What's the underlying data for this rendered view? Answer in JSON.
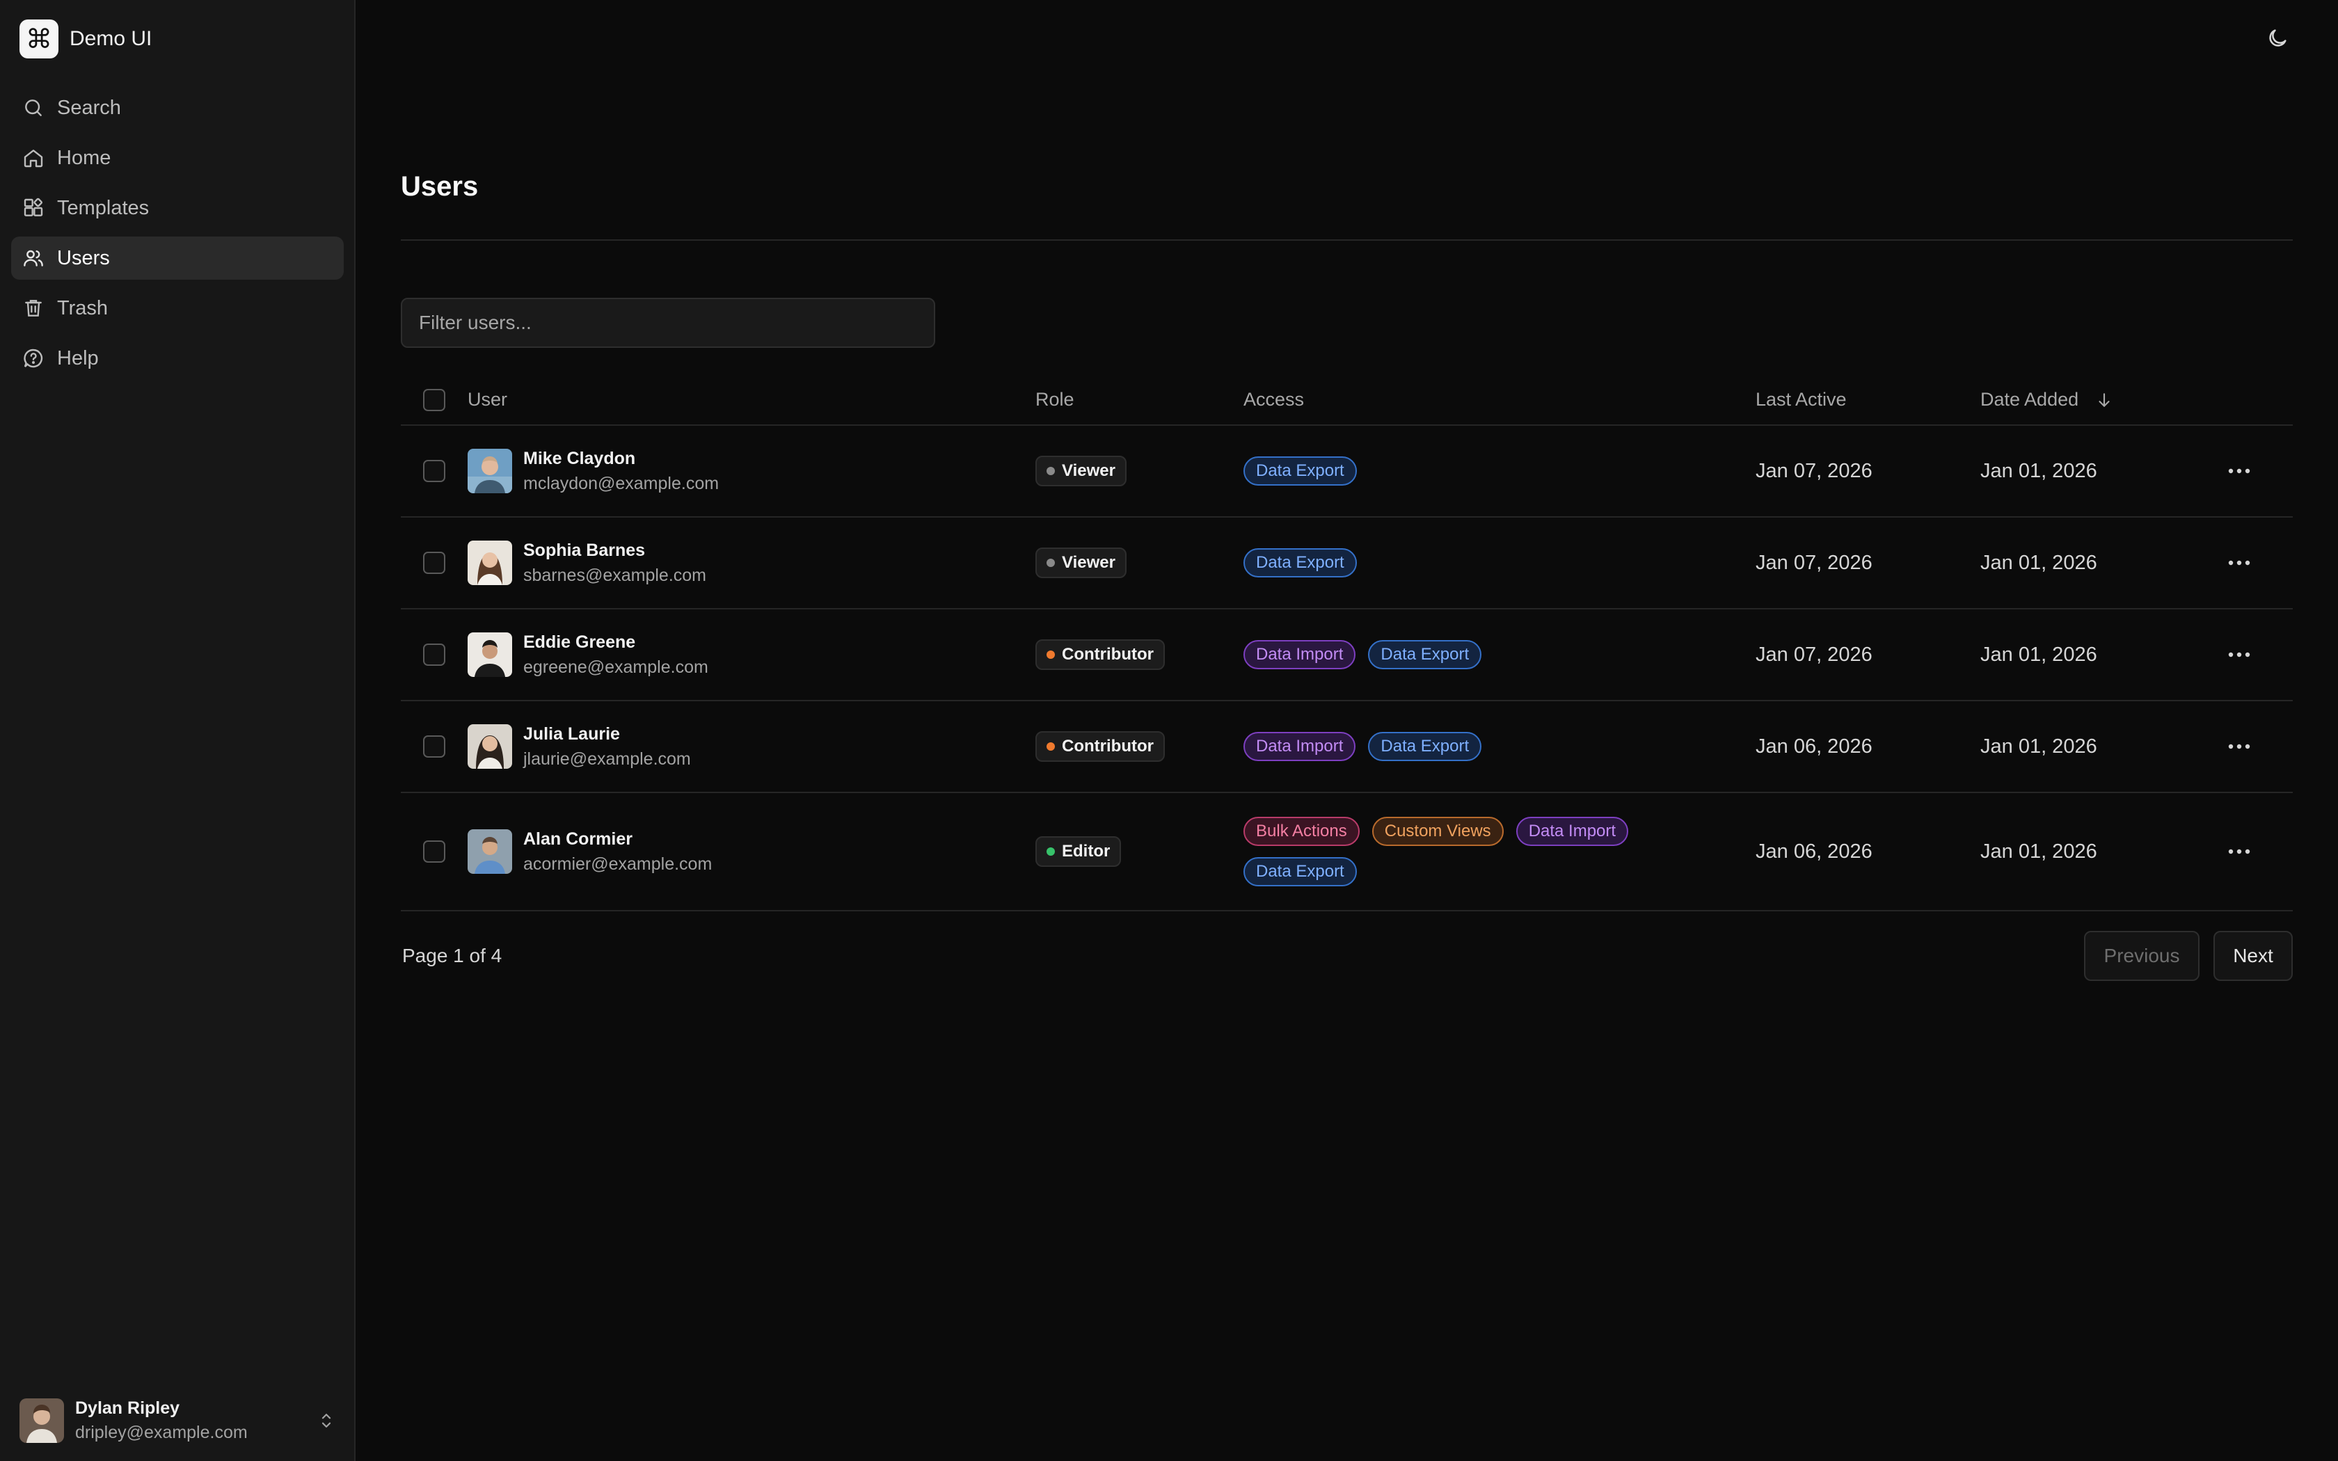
{
  "brand": {
    "logo_glyph": "⌘",
    "name": "Demo UI"
  },
  "nav": [
    {
      "label": "Search",
      "icon": "search-icon"
    },
    {
      "label": "Home",
      "icon": "home-icon"
    },
    {
      "label": "Templates",
      "icon": "templates-icon"
    },
    {
      "label": "Users",
      "icon": "users-icon",
      "active": true
    },
    {
      "label": "Trash",
      "icon": "trash-icon"
    },
    {
      "label": "Help",
      "icon": "help-icon"
    }
  ],
  "current_user": {
    "name": "Dylan Ripley",
    "email": "dripley@example.com"
  },
  "page": {
    "title": "Users"
  },
  "filter": {
    "placeholder": "Filter users..."
  },
  "table": {
    "columns": {
      "user": "User",
      "role": "Role",
      "access": "Access",
      "last_active": "Last Active",
      "date_added": "Date Added"
    },
    "sort": {
      "column": "date_added",
      "direction": "desc"
    },
    "rows": [
      {
        "name": "Mike Claydon",
        "email": "mclaydon@example.com",
        "role": "Viewer",
        "access": [
          "Data Export"
        ],
        "last_active": "Jan 07, 2026",
        "date_added": "Jan 01, 2026"
      },
      {
        "name": "Sophia Barnes",
        "email": "sbarnes@example.com",
        "role": "Viewer",
        "access": [
          "Data Export"
        ],
        "last_active": "Jan 07, 2026",
        "date_added": "Jan 01, 2026"
      },
      {
        "name": "Eddie Greene",
        "email": "egreene@example.com",
        "role": "Contributor",
        "access": [
          "Data Import",
          "Data Export"
        ],
        "last_active": "Jan 07, 2026",
        "date_added": "Jan 01, 2026"
      },
      {
        "name": "Julia Laurie",
        "email": "jlaurie@example.com",
        "role": "Contributor",
        "access": [
          "Data Import",
          "Data Export"
        ],
        "last_active": "Jan 06, 2026",
        "date_added": "Jan 01, 2026"
      },
      {
        "name": "Alan Cormier",
        "email": "acormier@example.com",
        "role": "Editor",
        "access": [
          "Bulk Actions",
          "Custom Views",
          "Data Import",
          "Data Export"
        ],
        "last_active": "Jan 06, 2026",
        "date_added": "Jan 01, 2026"
      }
    ]
  },
  "pagination": {
    "info": "Page 1 of 4",
    "previous": "Previous",
    "next": "Next"
  },
  "colors": {
    "role_viewer": "#8a8a8a",
    "role_contributor": "#f07a2e",
    "role_editor": "#37c26a",
    "tag_data_export": "#7fb0ff",
    "tag_data_import": "#c38cf5",
    "tag_bulk_actions": "#f37fa3",
    "tag_custom_views": "#f0a25f"
  }
}
